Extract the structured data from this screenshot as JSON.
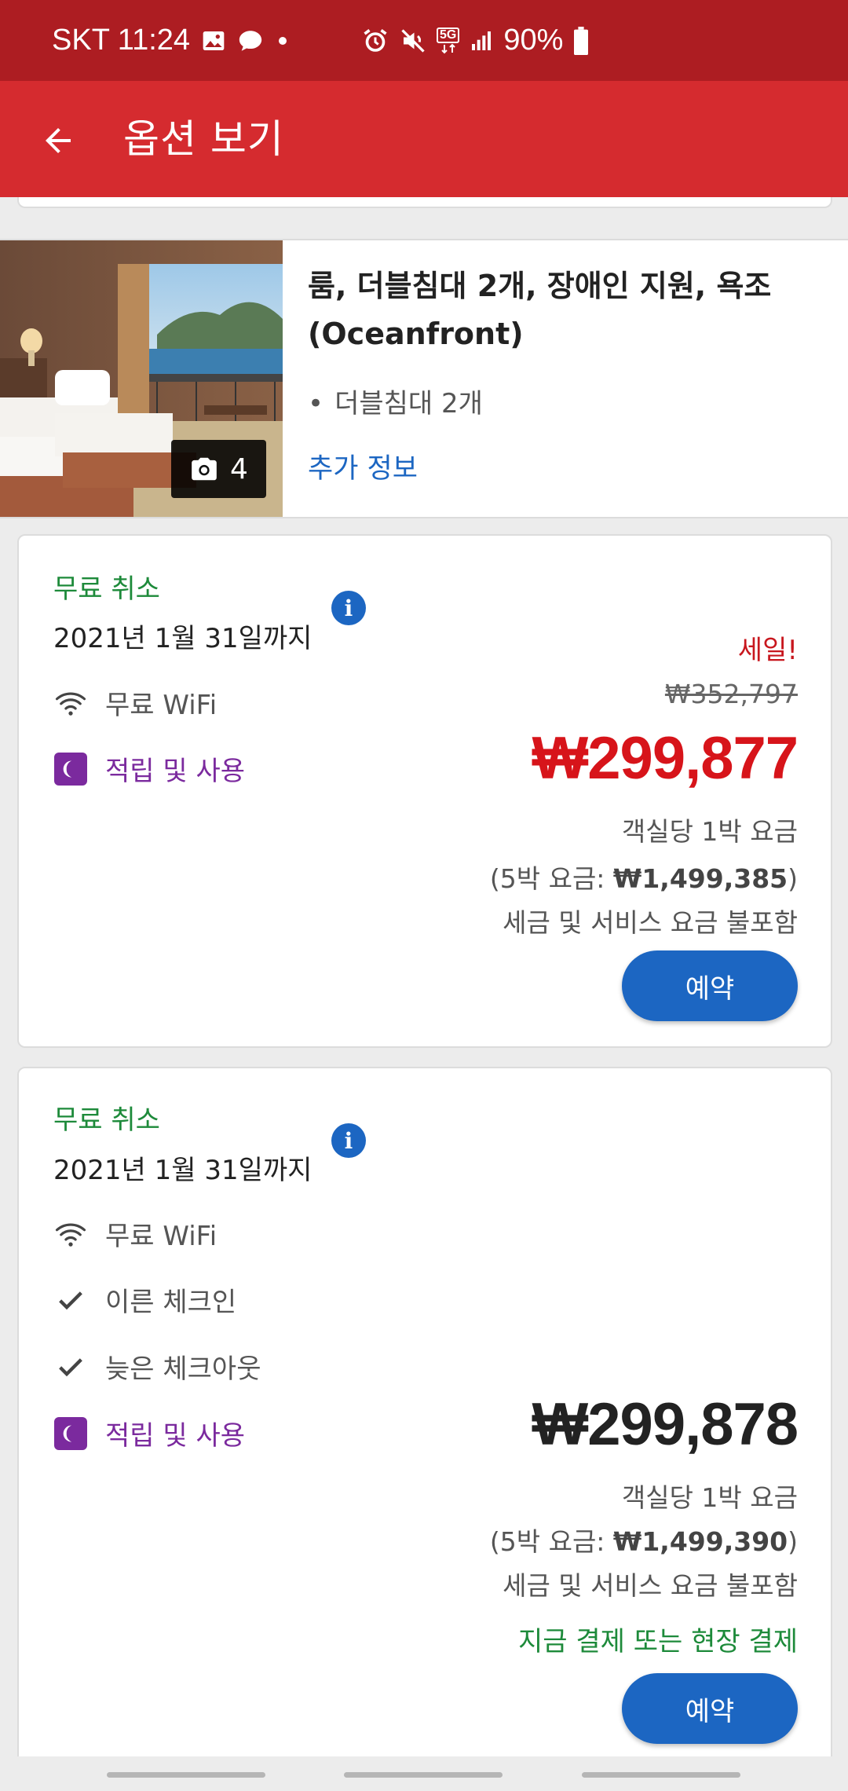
{
  "status_bar": {
    "carrier_time": "SKT 11:24",
    "network": "5G",
    "battery": "90%"
  },
  "app_bar": {
    "title": "옵션 보기"
  },
  "room": {
    "title": "룸, 더블침대 2개, 장애인 지원, 욕조 (Oceanfront)",
    "bed": "더블침대 2개",
    "photo_count": "4",
    "more_info": "추가 정보"
  },
  "rates": [
    {
      "cancel": "무료 취소",
      "until": "2021년 1월 31일까지",
      "amenities": [
        "무료 WiFi",
        "적립 및 사용"
      ],
      "sale": "세일!",
      "original_price": "₩352,797",
      "price": "₩299,877",
      "per_night": "객실당 1박 요금",
      "total_prefix": "(5박 요금: ",
      "total": "₩1,499,385",
      "total_suffix": ")",
      "tax_note": "세금 및 서비스 요금 불포함",
      "book": "예약"
    },
    {
      "cancel": "무료 취소",
      "until": "2021년 1월 31일까지",
      "amenities": [
        "무료 WiFi",
        "이른 체크인",
        "늦은 체크아웃",
        "적립 및 사용"
      ],
      "price": "₩299,878",
      "per_night": "객실당 1박 요금",
      "total_prefix": "(5박 요금: ",
      "total": "₩1,499,390",
      "total_suffix": ")",
      "tax_note": "세금 및 서비스 요금 불포함",
      "payment_option": "지금 결제 또는 현장 결제",
      "book": "예약"
    }
  ],
  "colors": {
    "status_bar": "#ad1d22",
    "app_bar": "#d52b2f",
    "accent_blue": "#1c66c2",
    "sale_red": "#d7141a",
    "free_cancel_green": "#1d8a3a",
    "rewards_purple": "#7b2a9e"
  }
}
